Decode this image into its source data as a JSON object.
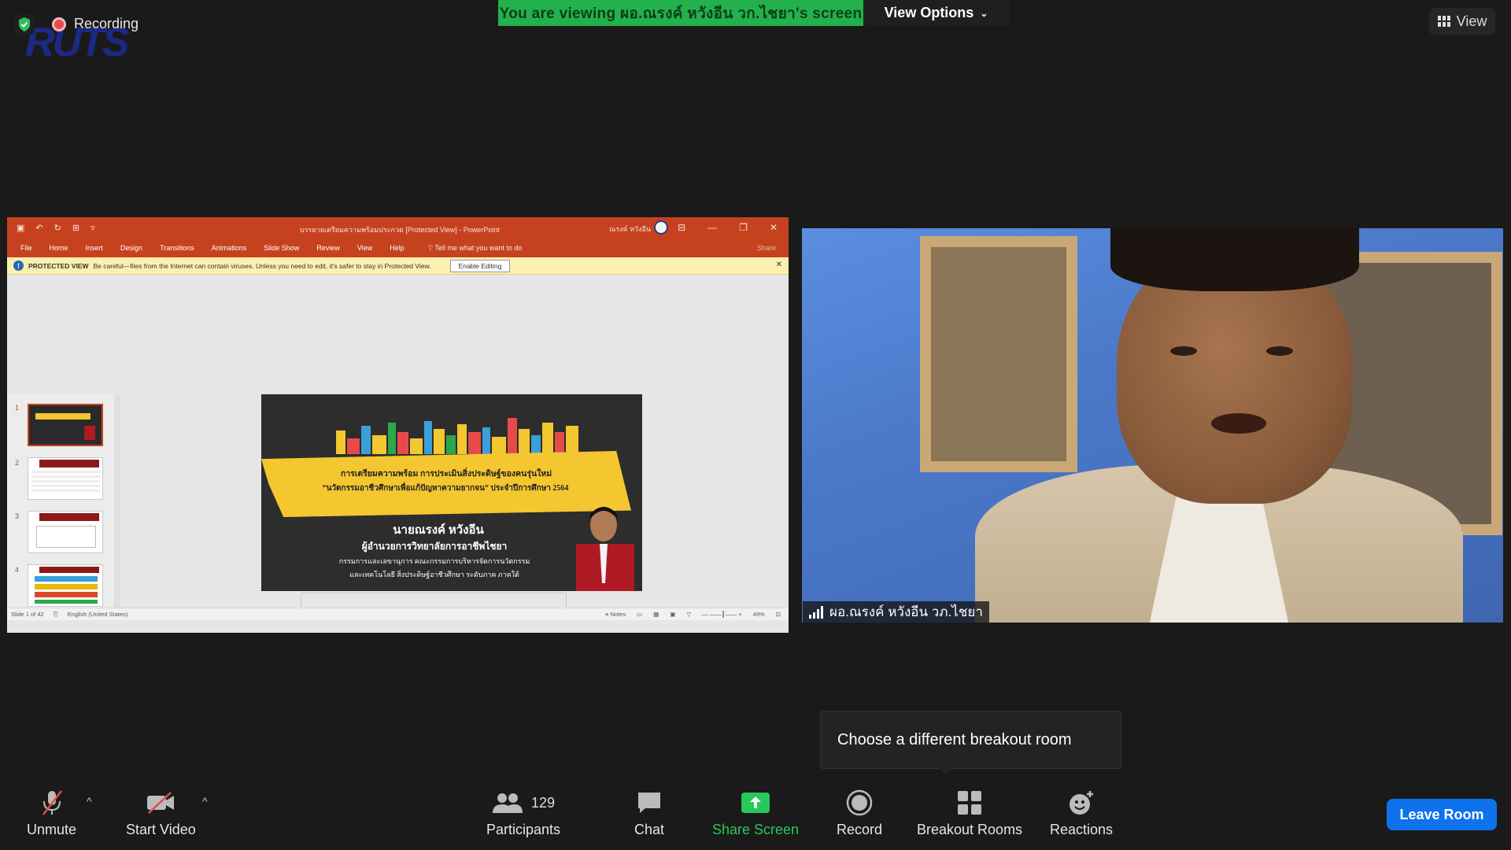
{
  "top": {
    "recording_label": "Recording",
    "logo_text": "RUTS",
    "viewing_banner": "You are viewing ผอ.ณรงค์ หวังอีน วก.ไชยา's screen",
    "view_options_label": "View Options",
    "view_button_label": "View"
  },
  "powerpoint": {
    "window_title": "บรรยายเตรียมความพร้อมประกวด [Protected View] - PowerPoint",
    "user_name": "ณรงค์ หวังอีน",
    "menu": [
      "File",
      "Home",
      "Insert",
      "Design",
      "Transitions",
      "Animations",
      "Slide Show",
      "Review",
      "View",
      "Help"
    ],
    "tell_me": "Tell me what you want to do",
    "share_label": "Share",
    "protected_label": "PROTECTED VIEW",
    "protected_message": "Be careful—files from the Internet can contain viruses. Unless you need to edit, it's safer to stay in Protected View.",
    "enable_editing": "Enable Editing",
    "thumb_numbers": [
      "1",
      "2",
      "3",
      "4"
    ],
    "status_slide": "Slide 1 of 42",
    "status_lang": "English (United States)",
    "status_notes": "Notes",
    "zoom": "49%",
    "slide": {
      "line1": "การเตรียมความพร้อม การประเมินสิ่งประดิษฐ์ของคนรุ่นใหม่",
      "line2": "“นวัตกรรมอาชีวศึกษาเพื่อแก้ปัญหาความยากจน” ประจำปีการศึกษา 2564",
      "name": "นายณรงค์ หวังอีน",
      "position": "ผู้อำนวยการวิทยาลัยการอาชีพไชยา",
      "role1": "กรรมการและเลขานุการ คณะกรรมการบริหารจัดการนวัตกรรม",
      "role2": "และเทคโนโลยี สิ่งประดิษฐ์อาชีวศึกษา ระดับภาค ภาคใต้"
    }
  },
  "video": {
    "participant_name": "ผอ.ณรงค์ หวังอีน วภ.ไชยา"
  },
  "tooltip": "Choose a different breakout room",
  "toolbar": {
    "unmute": "Unmute",
    "start_video": "Start Video",
    "participants_count": "129",
    "participants": "Participants",
    "chat": "Chat",
    "share_screen": "Share Screen",
    "record": "Record",
    "breakout_rooms": "Breakout Rooms",
    "reactions": "Reactions",
    "leave_room": "Leave Room"
  },
  "colors": {
    "banner_green": "#22b14c",
    "ppt_orange": "#c6421f",
    "leave_blue": "#0e72ed",
    "share_green": "#26c95a"
  }
}
